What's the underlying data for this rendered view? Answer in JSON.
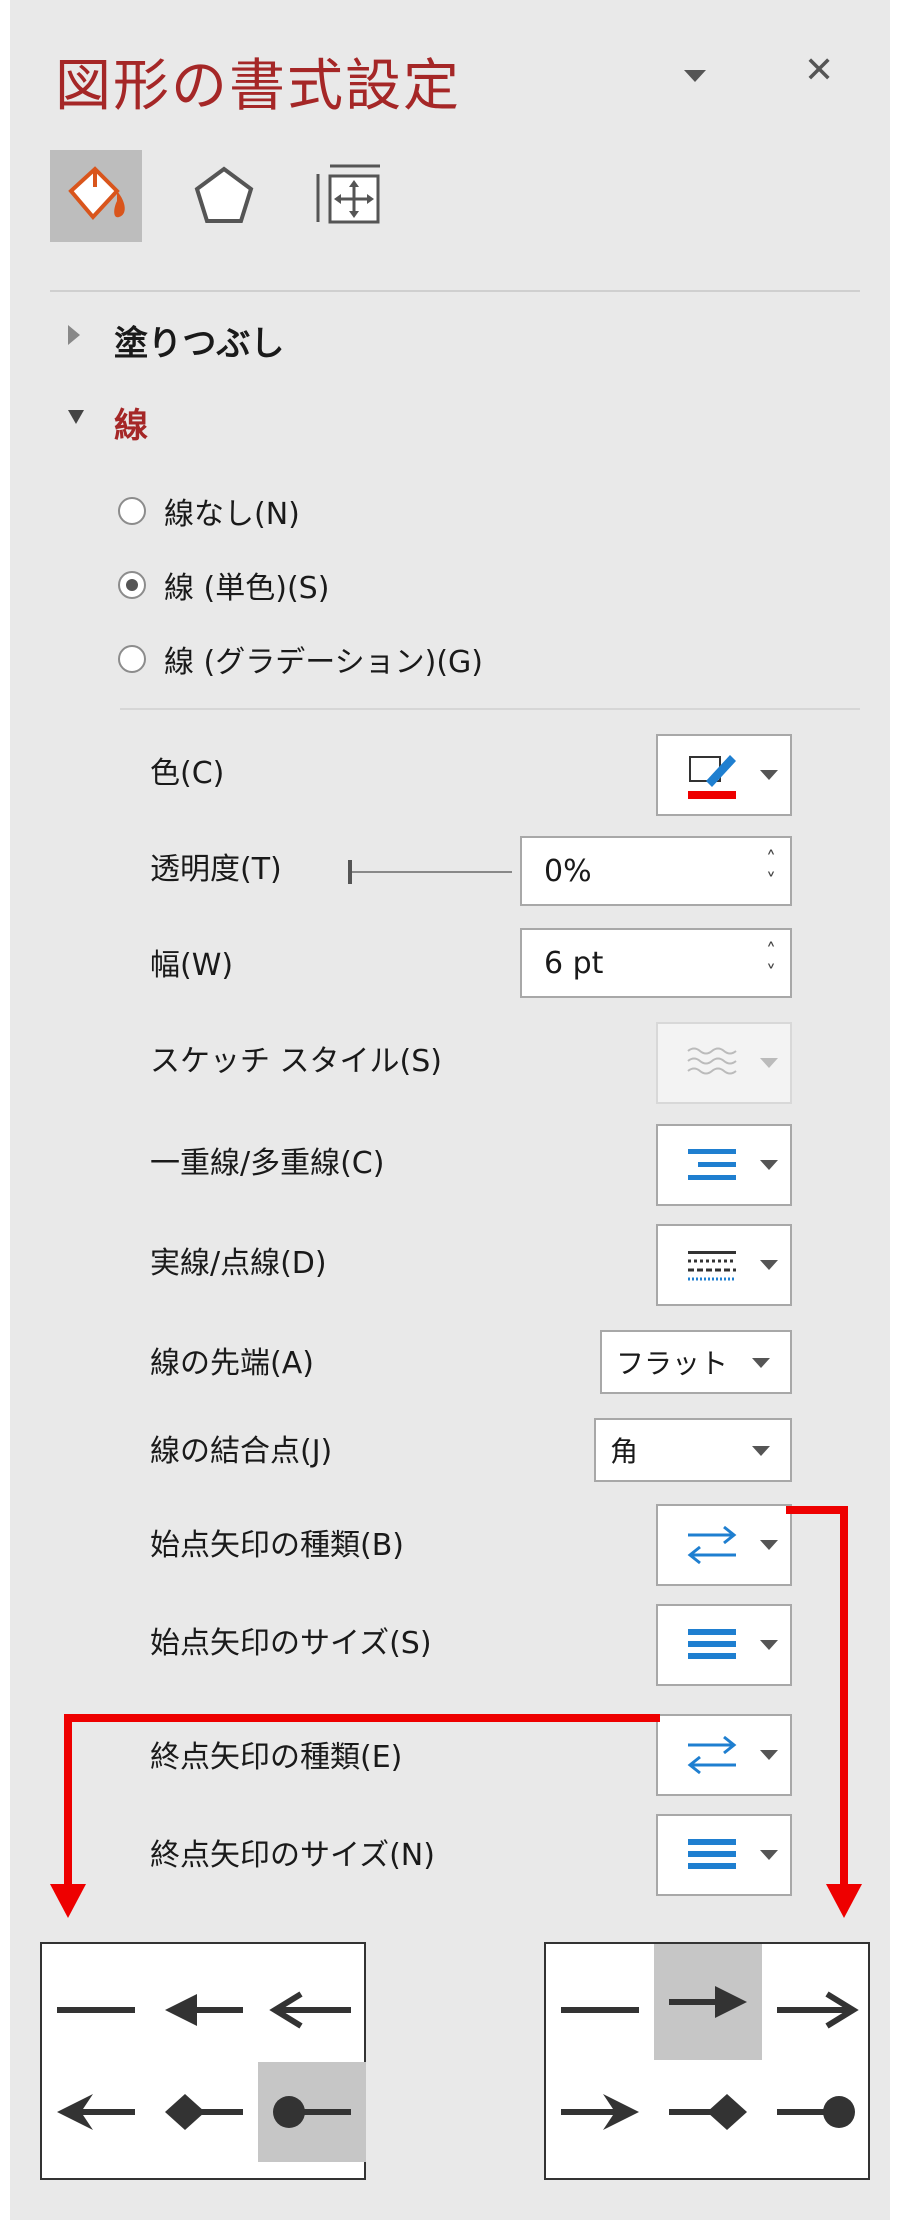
{
  "header": {
    "title": "図形の書式設定",
    "close": "✕"
  },
  "sections": {
    "fill": "塗りつぶし",
    "line": "線"
  },
  "line_type": {
    "options": [
      "線なし(N)",
      "線 (単色)(S)",
      "線 (グラデーション)(G)"
    ],
    "selected": "線 (単色)(S)"
  },
  "properties": {
    "color_label": "色(C)",
    "transparency_label": "透明度(T)",
    "transparency_value": "0%",
    "width_label": "幅(W)",
    "width_value": "6 pt",
    "sketch_label": "スケッチ スタイル(S)",
    "compound_label": "一重線/多重線(C)",
    "dash_label": "実線/点線(D)",
    "cap_label": "線の先端(A)",
    "cap_value": "フラット",
    "join_label": "線の結合点(J)",
    "join_value": "角",
    "begin_type_label": "始点矢印の種類(B)",
    "begin_size_label": "始点矢印のサイズ(S)",
    "end_type_label": "終点矢印の種類(E)",
    "end_size_label": "終点矢印のサイズ(N)"
  },
  "colors": {
    "title": "#a52727",
    "accent_blue": "#1f7fd0",
    "annotation_red": "#ee0000"
  }
}
